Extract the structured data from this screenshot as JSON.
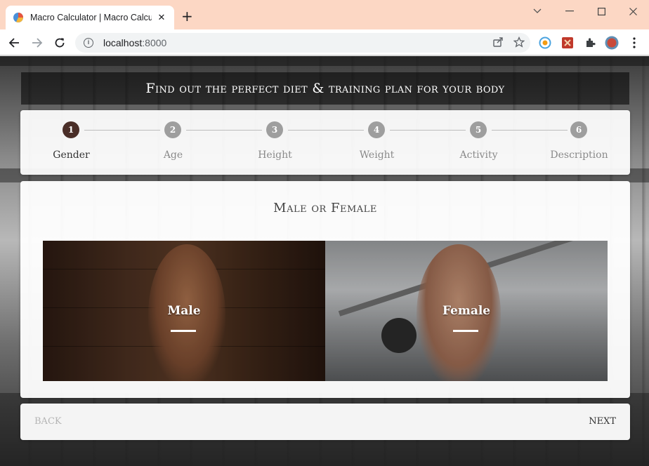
{
  "browser": {
    "tab_title": "Macro Calculator | Macro Calculator",
    "tab_close": "✕",
    "new_tab": "+",
    "url_host": "localhost",
    "url_port": ":8000"
  },
  "page": {
    "banner_title": "Find out the perfect diet & training plan for your body",
    "steps": [
      {
        "number": "1",
        "label": "Gender",
        "active": true
      },
      {
        "number": "2",
        "label": "Age",
        "active": false
      },
      {
        "number": "3",
        "label": "Height",
        "active": false
      },
      {
        "number": "4",
        "label": "Weight",
        "active": false
      },
      {
        "number": "5",
        "label": "Activity",
        "active": false
      },
      {
        "number": "6",
        "label": "Description",
        "active": false
      }
    ],
    "question": "Male or Female",
    "options": [
      {
        "label": "Male"
      },
      {
        "label": "Female"
      }
    ],
    "back_label": "BACK",
    "next_label": "NEXT"
  },
  "colors": {
    "active_step": "#4a2e28",
    "inactive_step": "#9e9e9e",
    "titlebar": "#fcd7c4"
  }
}
